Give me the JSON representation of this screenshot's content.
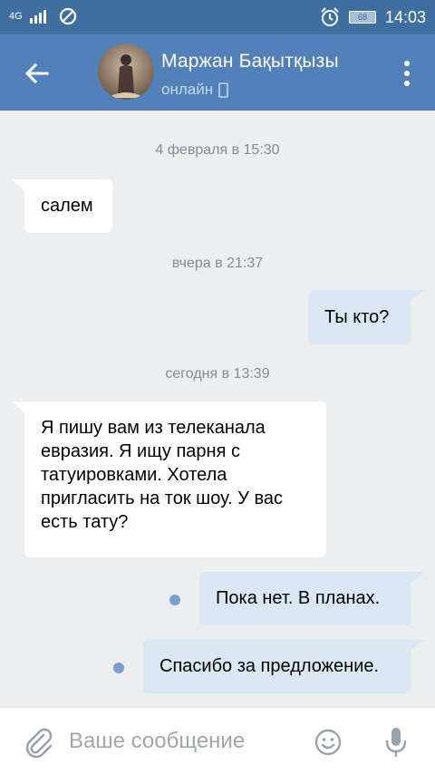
{
  "statusbar": {
    "network": "4G",
    "time": "14:03",
    "battery": "68",
    "icons": [
      "signal-icon",
      "do-not-disturb-icon",
      "alarm-icon",
      "battery-icon"
    ]
  },
  "header": {
    "contact_name": "Маржан Бақытқызы",
    "status": "онлайн",
    "icons": [
      "back-arrow-icon",
      "mobile-icon",
      "more-vert-icon"
    ]
  },
  "messages": [
    {
      "type": "date",
      "text": "4 февраля в 15:30"
    },
    {
      "type": "in",
      "text": "салем"
    },
    {
      "type": "date",
      "text": "вчера в 21:37"
    },
    {
      "type": "out",
      "text": "Ты кто?"
    },
    {
      "type": "date",
      "text": "сегодня в 13:39"
    },
    {
      "type": "in",
      "lines": [
        "Я пишу вам из телеканала",
        "евразия. Я ищу парня с",
        "татуировками. Хотела",
        "пригласить на ток шоу. У вас",
        "есть тату?"
      ]
    },
    {
      "type": "out",
      "text": "Пока нет. В планах.",
      "unread": true
    },
    {
      "type": "out",
      "text": "Спасибо за предложение.",
      "unread": true
    }
  ],
  "composer": {
    "placeholder": "Ваше сообщение",
    "icons": [
      "attach-icon",
      "emoji-icon",
      "microphone-icon"
    ]
  },
  "colors": {
    "statusbar": "#3f6fa1",
    "appbar": "#5181b8",
    "background": "#edeef0",
    "bubble_in": "#ffffff",
    "bubble_out": "#dbe7f5",
    "unread_dot": "#7a9fcf"
  }
}
